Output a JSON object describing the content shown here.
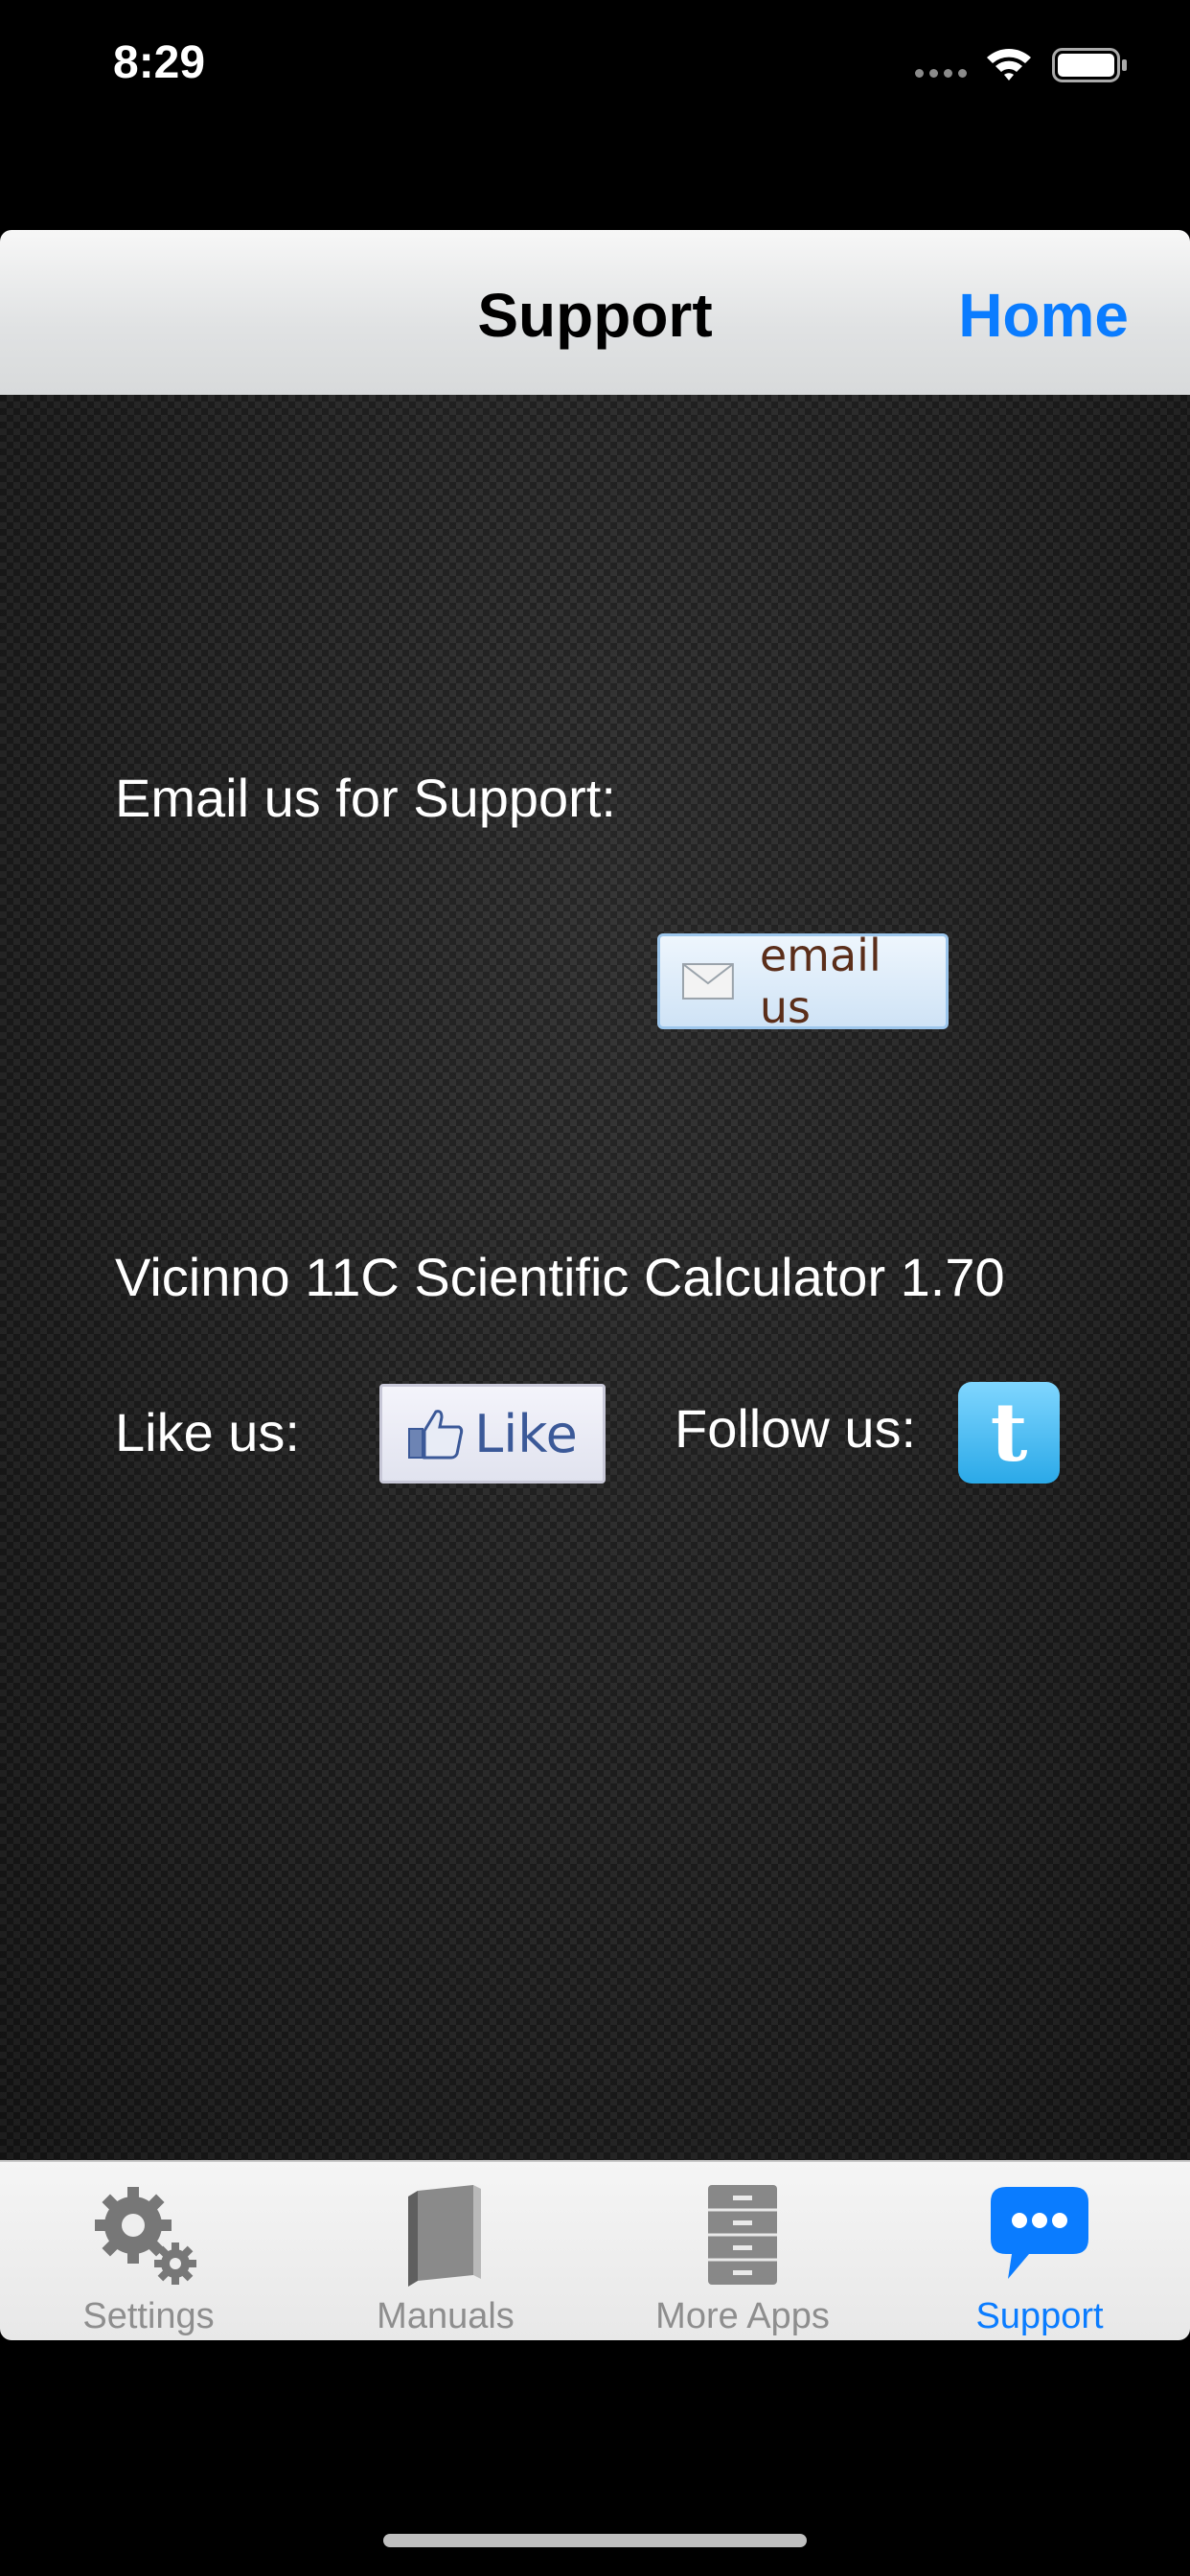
{
  "status_bar": {
    "time": "8:29"
  },
  "navbar": {
    "title": "Support",
    "home_label": "Home"
  },
  "content": {
    "email_label": "Email us for Support:",
    "email_button_label": "email us",
    "app_version": "Vicinno 11C Scientific Calculator 1.70",
    "like_label": "Like us:",
    "like_button_label": "Like",
    "follow_label": "Follow us:"
  },
  "tabbar": {
    "active_color": "#0a7cff",
    "inactive_color": "#8e8e8e",
    "tabs": [
      {
        "label": "Settings",
        "icon": "gear-icon"
      },
      {
        "label": "Manuals",
        "icon": "book-icon"
      },
      {
        "label": "More Apps",
        "icon": "cabinet-icon"
      },
      {
        "label": "Support",
        "icon": "chat-bubble-icon",
        "active": true
      }
    ]
  }
}
